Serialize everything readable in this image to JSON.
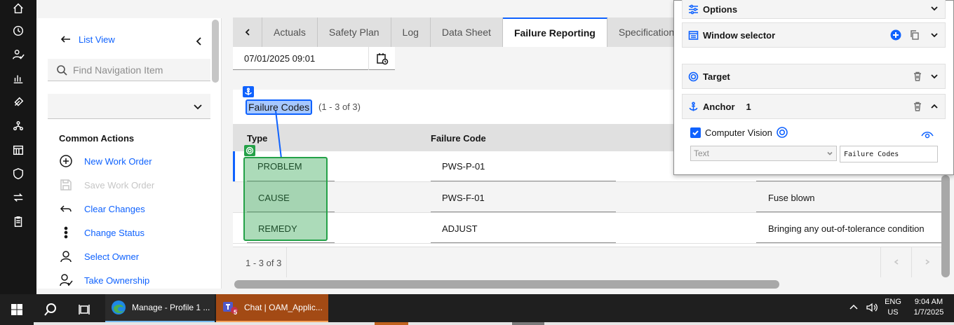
{
  "nav": {
    "list_view": "List View",
    "find_placeholder": "Find Navigation Item",
    "common_actions_title": "Common Actions",
    "actions": [
      {
        "label": "New Work Order",
        "enabled": true
      },
      {
        "label": "Save Work Order",
        "enabled": false
      },
      {
        "label": "Clear Changes",
        "enabled": true
      },
      {
        "label": "Change Status",
        "enabled": true
      },
      {
        "label": "Select Owner",
        "enabled": true
      },
      {
        "label": "Take Ownership",
        "enabled": true
      }
    ]
  },
  "tabs": [
    "Actuals",
    "Safety Plan",
    "Log",
    "Data Sheet",
    "Failure Reporting",
    "Specification"
  ],
  "active_tab": "Failure Reporting",
  "date_value": "07/01/2025 09:01",
  "table": {
    "title": "Failure Codes",
    "count": "(1 - 3 of 3)",
    "columns": [
      "Type",
      "Failure Code"
    ],
    "rows": [
      {
        "type": "PROBLEM",
        "code": "PWS-P-01",
        "description": ""
      },
      {
        "type": "CAUSE",
        "code": "PWS-F-01",
        "description": "Fuse blown"
      },
      {
        "type": "REMEDY",
        "code": "ADJUST",
        "description": "Bringing any out-of-tolerance condition"
      }
    ],
    "footer_count": "1 - 3 of 3"
  },
  "panel": {
    "options": "Options",
    "window_selector": "Window selector",
    "target": "Target",
    "anchor": "Anchor",
    "anchor_number": "1",
    "computer_vision": "Computer Vision",
    "selector_type": "Text",
    "selector_value": "Failure Codes"
  },
  "taskbar": {
    "edge_label": "Manage - Profile 1 ...",
    "teams_label": "Chat | OAM_Applic...",
    "teams_badge": "5",
    "language": "ENG",
    "region": "US",
    "time": "9:04 AM",
    "date": "1/7/2025"
  },
  "colors": {
    "accent": "#0f62fe",
    "target_green": "#24a148",
    "teams_orange": "#a34a14"
  }
}
